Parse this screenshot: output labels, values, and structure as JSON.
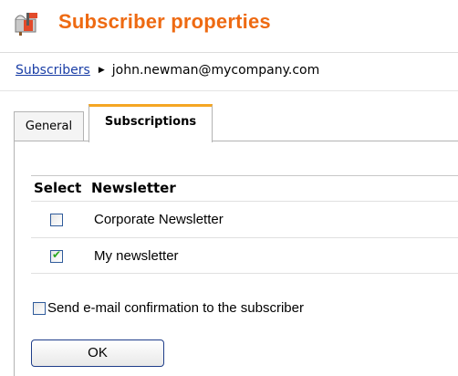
{
  "header": {
    "title": "Subscriber properties",
    "icon": "mailbox-icon"
  },
  "breadcrumb": {
    "parent": "Subscribers",
    "separator": "▶",
    "current": "john.newman@mycompany.com"
  },
  "tabs": [
    {
      "label": "General",
      "active": false
    },
    {
      "label": "Subscriptions",
      "active": true
    }
  ],
  "table": {
    "headers": [
      "Select",
      "Newsletter"
    ],
    "rows": [
      {
        "name": "Corporate Newsletter",
        "checked": false
      },
      {
        "name": "My newsletter",
        "checked": true
      }
    ]
  },
  "confirm": {
    "label": "Send e-mail confirmation to the subscriber",
    "checked": false
  },
  "ok_button": {
    "label": "OK"
  },
  "colors": {
    "title": "#ee6a12",
    "link": "#1a3ea6",
    "tab_accent": "#f5a623",
    "check": "#2aa81e"
  }
}
